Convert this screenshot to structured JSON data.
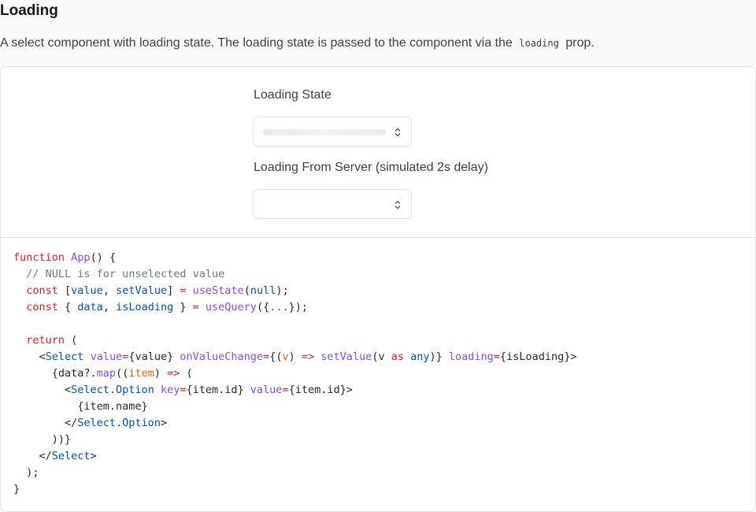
{
  "header": {
    "title": "Loading",
    "description_before": "A select component with loading state. The loading state is passed to the component via the",
    "description_code": "loading",
    "description_after": "prop."
  },
  "preview": {
    "select1": {
      "label": "Loading State",
      "loading": true,
      "icon": "chevron-updown-icon"
    },
    "select2": {
      "label": "Loading From Server (simulated 2s delay)",
      "value": "",
      "icon": "chevron-updown-icon"
    }
  },
  "code": {
    "lines": [
      [
        [
          "function",
          "kw"
        ],
        [
          " ",
          ""
        ],
        [
          "App",
          "fn"
        ],
        [
          "() {",
          ""
        ]
      ],
      [
        [
          "  ",
          ""
        ],
        [
          "// NULL is for unselected value",
          "cm"
        ]
      ],
      [
        [
          "  ",
          ""
        ],
        [
          "const",
          "kw"
        ],
        [
          " [",
          ""
        ],
        [
          "value",
          "var"
        ],
        [
          ", ",
          ""
        ],
        [
          "setValue",
          "var"
        ],
        [
          "] ",
          ""
        ],
        [
          "=",
          "op"
        ],
        [
          " ",
          ""
        ],
        [
          "useState",
          "fn"
        ],
        [
          "(",
          ""
        ],
        [
          "null",
          "var"
        ],
        [
          ");",
          ""
        ]
      ],
      [
        [
          "  ",
          ""
        ],
        [
          "const",
          "kw"
        ],
        [
          " { ",
          ""
        ],
        [
          "data",
          "var"
        ],
        [
          ", ",
          ""
        ],
        [
          "isLoading",
          "var"
        ],
        [
          " } ",
          ""
        ],
        [
          "=",
          "op"
        ],
        [
          " ",
          ""
        ],
        [
          "useQuery",
          "fn"
        ],
        [
          "({",
          ""
        ],
        [
          "...",
          "op"
        ],
        [
          "});",
          ""
        ]
      ],
      [],
      [
        [
          "  ",
          ""
        ],
        [
          "return",
          "kw"
        ],
        [
          " (",
          ""
        ]
      ],
      [
        [
          "    <",
          ""
        ],
        [
          "Select",
          "tag"
        ],
        [
          " ",
          ""
        ],
        [
          "value",
          "attr"
        ],
        [
          "=",
          "op"
        ],
        [
          "{value} ",
          ""
        ],
        [
          "onValueChange",
          "attr"
        ],
        [
          "=",
          "op"
        ],
        [
          "{(",
          ""
        ],
        [
          "v",
          "prm"
        ],
        [
          ") ",
          ""
        ],
        [
          "=>",
          "op"
        ],
        [
          " ",
          ""
        ],
        [
          "setValue",
          "fn"
        ],
        [
          "(v ",
          ""
        ],
        [
          "as",
          "kw"
        ],
        [
          " ",
          ""
        ],
        [
          "any",
          "var"
        ],
        [
          ")} ",
          ""
        ],
        [
          "loading",
          "attr"
        ],
        [
          "=",
          "op"
        ],
        [
          "{isLoading}>",
          ""
        ]
      ],
      [
        [
          "      {data?.",
          ""
        ],
        [
          "map",
          "fn"
        ],
        [
          "((",
          ""
        ],
        [
          "item",
          "prm"
        ],
        [
          ") ",
          ""
        ],
        [
          "=>",
          "op"
        ],
        [
          " (",
          ""
        ]
      ],
      [
        [
          "        <",
          ""
        ],
        [
          "Select.Option",
          "tag"
        ],
        [
          " ",
          ""
        ],
        [
          "key",
          "attr"
        ],
        [
          "=",
          "op"
        ],
        [
          "{item.id} ",
          ""
        ],
        [
          "value",
          "attr"
        ],
        [
          "=",
          "op"
        ],
        [
          "{item.id}>",
          ""
        ]
      ],
      [
        [
          "          {item.name}",
          ""
        ]
      ],
      [
        [
          "        </",
          ""
        ],
        [
          "Select.Option",
          "tag"
        ],
        [
          ">",
          ""
        ]
      ],
      [
        [
          "      ))}",
          ""
        ]
      ],
      [
        [
          "    </",
          ""
        ],
        [
          "Select",
          "tag"
        ],
        [
          ">",
          ""
        ]
      ],
      [
        [
          "  );",
          ""
        ]
      ],
      [
        [
          "}",
          ""
        ]
      ]
    ]
  }
}
